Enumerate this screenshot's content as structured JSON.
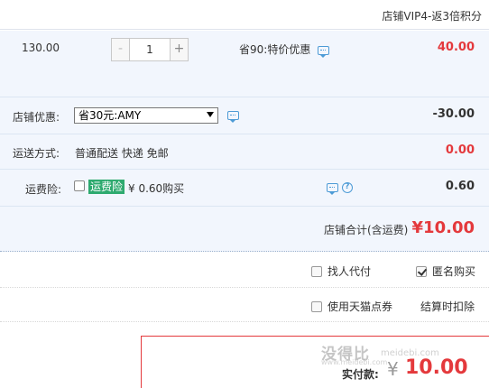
{
  "header": {
    "vip_text": "店铺VIP4-返3倍积分"
  },
  "item": {
    "price": "130.00",
    "qty_minus": "-",
    "qty_value": "1",
    "qty_plus": "+",
    "discount_text": "省90:特价优惠",
    "subtotal": "40.00"
  },
  "shop_discount": {
    "label": "店铺优惠:",
    "selected": "省30元:AMY",
    "amount": "-30.00"
  },
  "shipping": {
    "label": "运送方式:",
    "method": "普通配送 快递 免邮",
    "amount": "0.00"
  },
  "insurance": {
    "label": "运费险:",
    "badge": "运费险",
    "text": "¥ 0.60购买",
    "help_glyph": "?",
    "amount": "0.60"
  },
  "summary": {
    "label": "店铺合计(含运费)",
    "value": "¥10.00"
  },
  "options": {
    "proxy_pay": "找人代付",
    "anonymous": "匿名购买",
    "use_points": "使用天猫点券",
    "settle_note": "结算时扣除"
  },
  "payment": {
    "label": "实付款:",
    "yen": "¥",
    "value": "10.00"
  },
  "watermark": {
    "main": "没得比",
    "sub": "meidebi.com",
    "url": "www.meidebi.com"
  },
  "colors": {
    "accent_red": "#e4393c",
    "panel_blue": "#f2f6fd",
    "badge_green": "#2eaa6f",
    "icon_blue": "#4d9bd6"
  }
}
